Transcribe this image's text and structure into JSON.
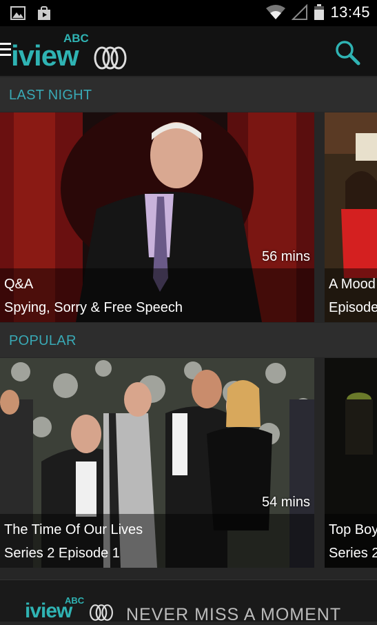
{
  "status_bar": {
    "left_icons": [
      "image-icon",
      "shopping-bag-icon"
    ],
    "right_icons": [
      "wifi-icon",
      "signal-icon",
      "battery-icon"
    ],
    "time": "13:45"
  },
  "app_bar": {
    "logo_abc": "ABC",
    "logo_word": "iview",
    "accent_color": "#2fb3b3"
  },
  "sections": [
    {
      "title": "LAST NIGHT",
      "cards": [
        {
          "title": "Q&A",
          "subtitle": "Spying, Sorry & Free Speech",
          "duration": "56 mins"
        },
        {
          "title": "A Mood",
          "subtitle": "Episode"
        }
      ]
    },
    {
      "title": "POPULAR",
      "cards": [
        {
          "title": "The Time Of Our Lives",
          "subtitle": "Series 2 Episode 1",
          "duration": "54 mins"
        },
        {
          "title": "Top Boy",
          "subtitle": "Series 2"
        }
      ]
    }
  ],
  "banner": {
    "logo_abc": "ABC",
    "logo_word": "iview",
    "tagline": "NEVER MISS A MOMENT"
  }
}
